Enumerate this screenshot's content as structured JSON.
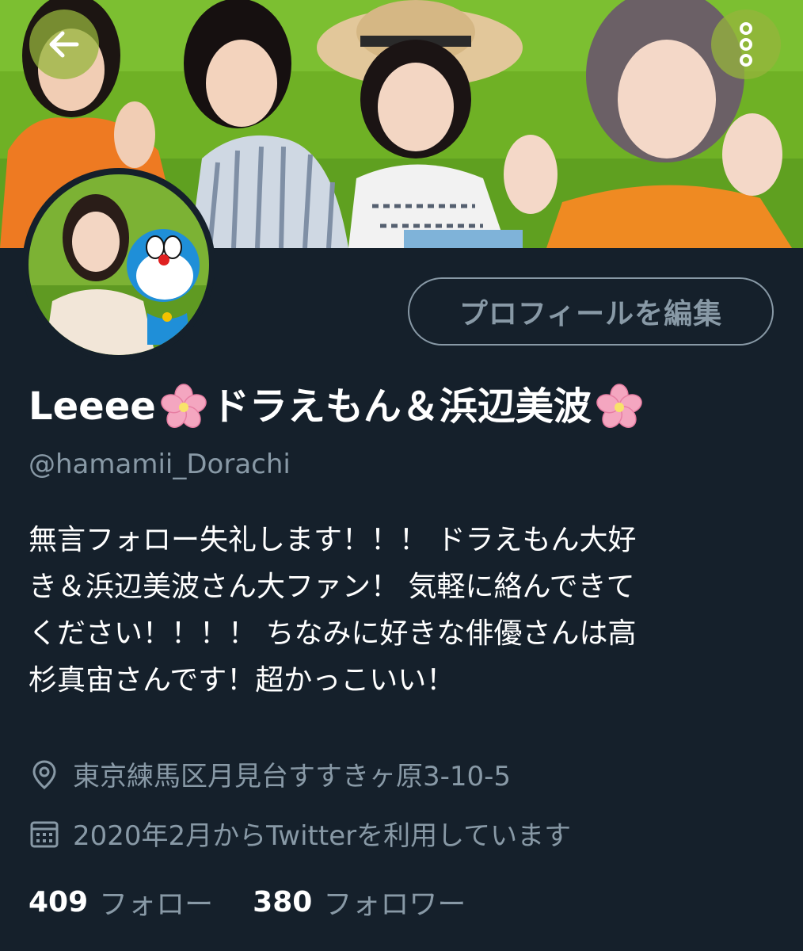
{
  "header": {
    "back_icon": "arrow-left-icon",
    "more_icon": "vertical-ellipsis-icon",
    "accent_overlay": "#96b43c"
  },
  "profile": {
    "edit_button_label": "プロフィールを編集",
    "display_name_prefix": "Leeee",
    "display_name_main": "ドラえもん＆浜辺美波",
    "name_emoji": "cherry-blossom-icon",
    "handle": "@hamamii_Dorachi",
    "bio_lines": [
      "無言フォロー失礼します！！！ ドラえもん大好",
      "き＆浜辺美波さん大ファン！ 気軽に絡んできて",
      "ください！！！！ ちなみに好きな俳優さんは高",
      "杉真宙さんです！超かっこいい！"
    ],
    "location": "東京練馬区月見台すすきヶ原3-10-5",
    "joined": "2020年2月からTwitterを利用しています",
    "following_count": "409",
    "following_label": "フォロー",
    "followers_count": "380",
    "followers_label": "フォロワー"
  },
  "colors": {
    "background": "#15202b",
    "secondary_text": "#8899a6",
    "primary_text": "#ffffff",
    "banner_green": "#6fb125",
    "flower_pink": "#f4a6c0"
  }
}
